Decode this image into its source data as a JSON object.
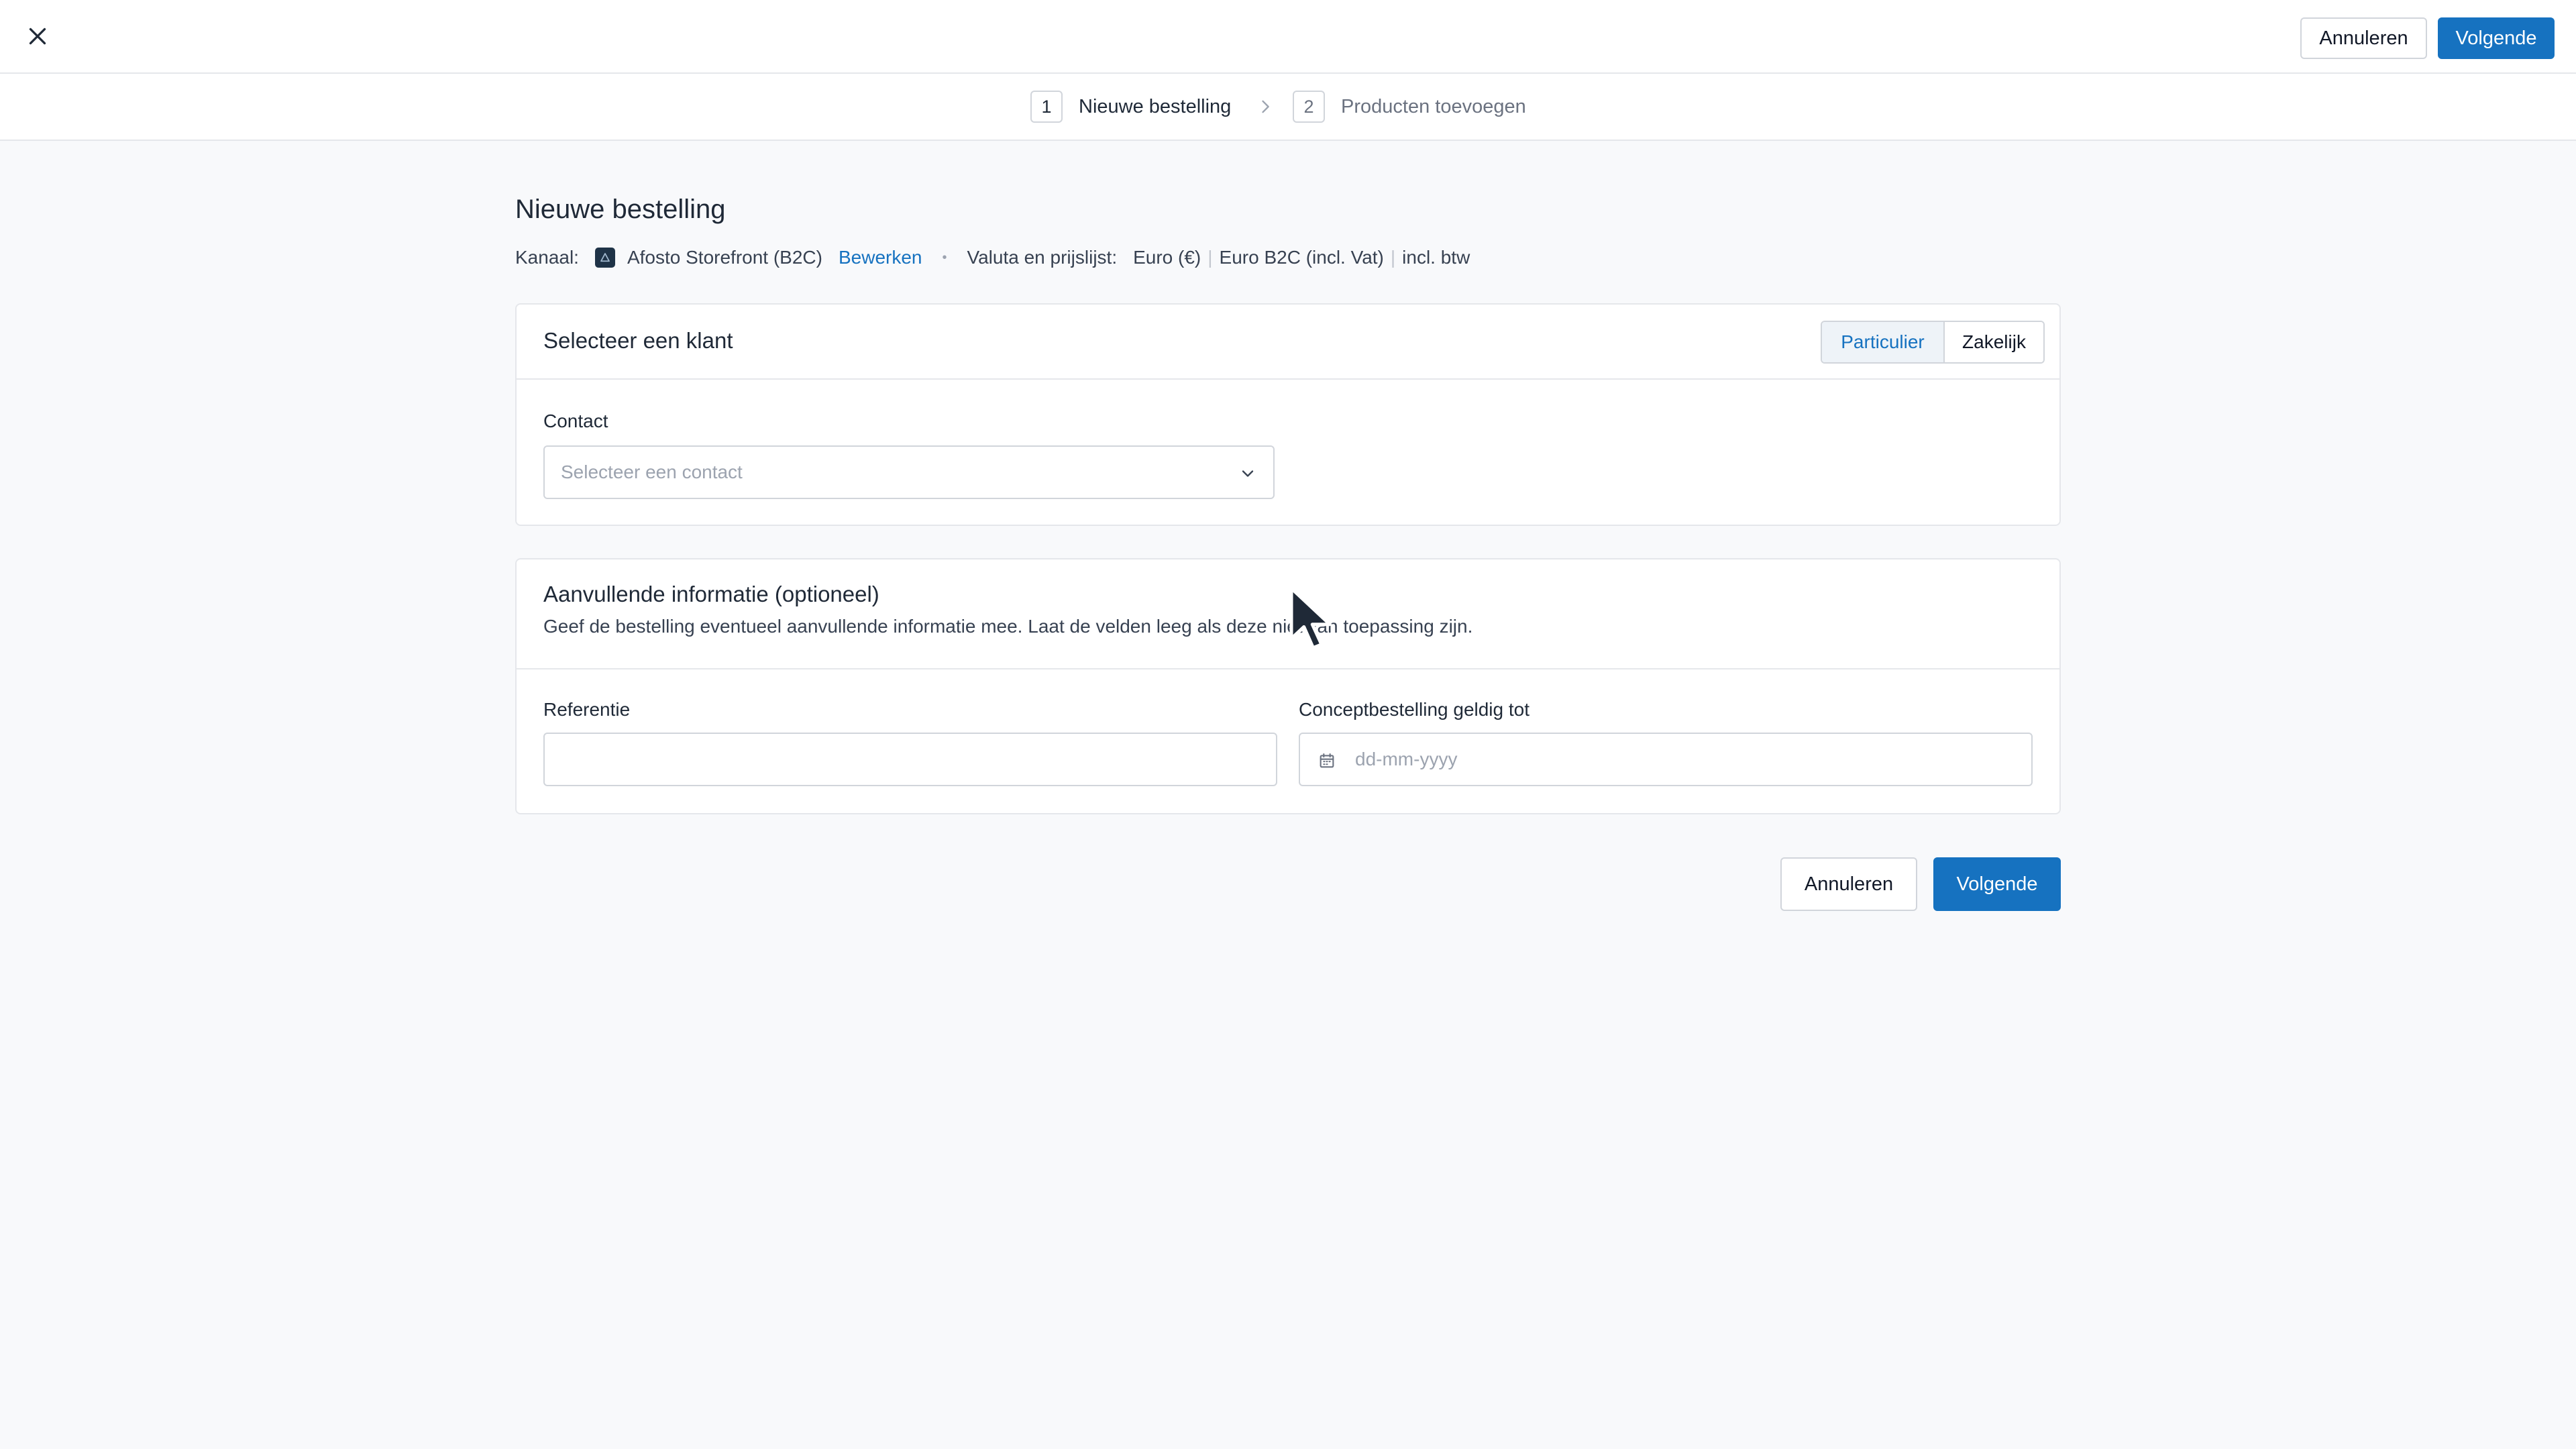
{
  "topbar": {
    "close_icon": "close-icon",
    "cancel_label": "Annuleren",
    "next_label": "Volgende"
  },
  "stepper": {
    "steps": [
      {
        "number": "1",
        "label": "Nieuwe bestelling",
        "state": "active"
      },
      {
        "number": "2",
        "label": "Producten toevoegen",
        "state": "upcoming"
      }
    ],
    "separator_icon": "chevron-right-icon"
  },
  "page": {
    "title": "Nieuwe bestelling",
    "channel_label": "Kanaal:",
    "channel_name": "Afosto Storefront (B2C)",
    "edit_link": "Bewerken",
    "bullet": "•",
    "currency_label": "Valuta en prijslijst:",
    "currency": "Euro (€)",
    "pipe": "|",
    "pricelist": "Euro B2C (incl. Vat)",
    "tax": "incl. btw"
  },
  "customer_card": {
    "title": "Selecteer een klant",
    "segments": [
      {
        "label": "Particulier",
        "selected": true
      },
      {
        "label": "Zakelijk",
        "selected": false
      }
    ],
    "contact_label": "Contact",
    "contact_placeholder": "Selecteer een contact"
  },
  "additional_card": {
    "title": "Aanvullende informatie (optioneel)",
    "description": "Geef de bestelling eventueel aanvullende informatie mee. Laat de velden leeg als deze niet van toepassing zijn.",
    "reference_label": "Referentie",
    "reference_value": "",
    "valid_until_label": "Conceptbestelling geldig tot",
    "valid_until_placeholder": "dd-mm-yyyy"
  },
  "footer": {
    "cancel_label": "Annuleren",
    "next_label": "Volgende"
  },
  "colors": {
    "primary": "#1672c0",
    "background": "#f8f9fb",
    "border": "#e5e7eb"
  }
}
